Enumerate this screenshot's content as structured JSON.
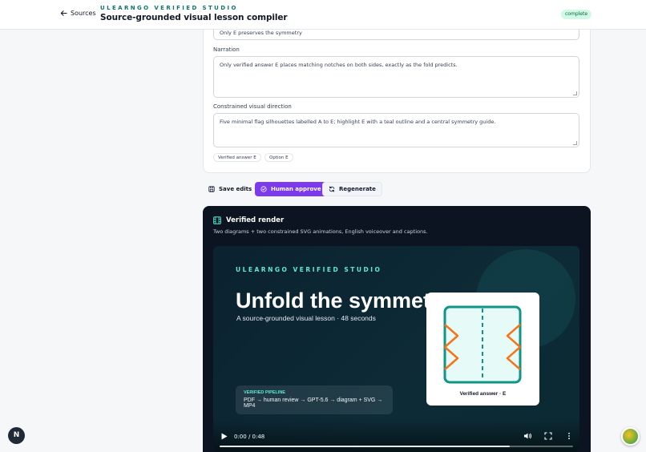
{
  "header": {
    "back_label": "Sources",
    "kicker": "ULEARNGO VERIFIED STUDIO",
    "title": "Source-grounded visual lesson compiler",
    "status": "complete"
  },
  "editor": {
    "answer_value": "Only E preserves the symmetry",
    "narration_label": "Narration",
    "narration_value": "Only verified answer E places matching notches on both sides, exactly as the fold predicts.",
    "visual_label": "Constrained visual direction",
    "visual_value": "Five minimal flag silhouettes labelled A to E; highlight E with a teal outline and a central symmetry guide.",
    "chips": [
      "Verified answer E",
      "Option E"
    ]
  },
  "actions": {
    "save": "Save edits",
    "approve": "Human approve",
    "regenerate": "Regenerate"
  },
  "render": {
    "title": "Verified render",
    "subtitle": "Two diagrams + two constrained SVG animations, English voiceover and captions.",
    "video": {
      "kicker": "ULEARNGO VERIFIED STUDIO",
      "title": "Unfold the symmetry",
      "subtitle": "A source-grounded visual lesson · 48 seconds",
      "panel_caption": "Verified answer · E",
      "pipeline_label": "VERIFIED PIPELINE",
      "pipeline_text": "PDF → human review → GPT-5.6 → diagram + SVG → MP4",
      "time": "0:00 / 0:48",
      "progress": 0.82
    }
  },
  "fab_left_label": "N",
  "colors": {
    "accent": "#7c3aed",
    "teal": "#0f766e",
    "notch": "#f97316"
  }
}
